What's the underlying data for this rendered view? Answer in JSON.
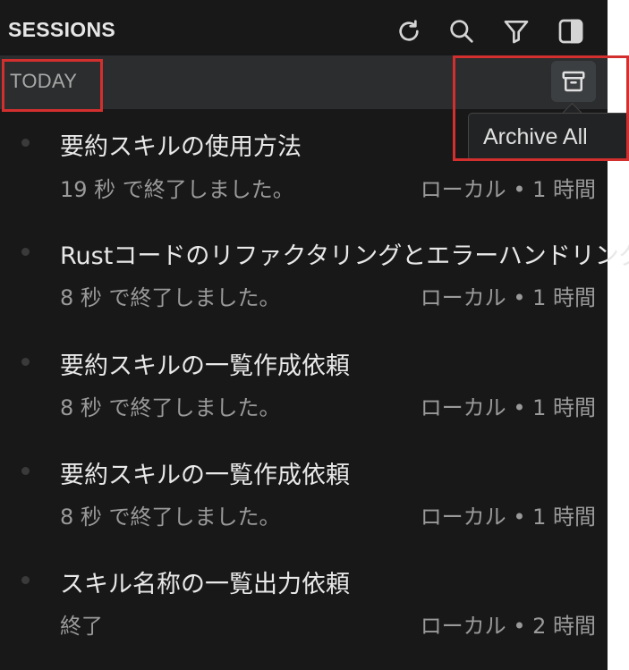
{
  "header": {
    "title": "SESSIONS",
    "icons": [
      "refresh-icon",
      "search-icon",
      "filter-icon",
      "toggle-panel-icon"
    ]
  },
  "section": {
    "label": "TODAY",
    "archive_icon": "archive-icon",
    "tooltip": "Archive All"
  },
  "sessions": [
    {
      "title": "要約スキルの使用方法",
      "status": "19 秒 で終了しました。",
      "meta": "ローカル • 1 時間"
    },
    {
      "title": "Rustコードのリファクタリングとエラーハンドリング",
      "status": "8 秒 で終了しました。",
      "meta": "ローカル • 1 時間"
    },
    {
      "title": "要約スキルの一覧作成依頼",
      "status": "8 秒 で終了しました。",
      "meta": "ローカル • 1 時間"
    },
    {
      "title": "要約スキルの一覧作成依頼",
      "status": "8 秒 で終了しました。",
      "meta": "ローカル • 1 時間"
    },
    {
      "title": "スキル名称の一覧出力依頼",
      "status": "終了",
      "meta": "ローカル • 2 時間"
    }
  ],
  "colors": {
    "background": "#181818",
    "section_background": "#2b2d2e",
    "highlight": "#d32f2f"
  }
}
